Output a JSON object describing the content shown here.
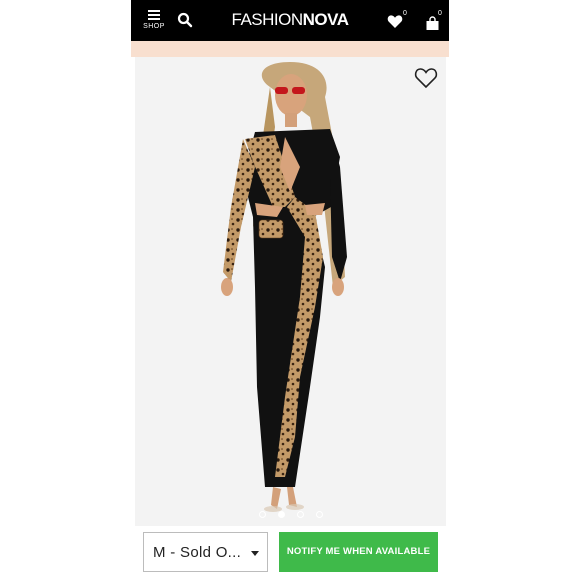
{
  "header": {
    "menu_label": "SHOP",
    "menu_icon": "hamburger-icon",
    "search_icon": "search-icon",
    "logo_part1": "FASHION",
    "logo_part2": "NOVA",
    "wishlist_count": "0",
    "cart_count": "0"
  },
  "product": {
    "image_description_icon": "product-photo",
    "wishlist_icon": "heart-outline-icon",
    "gallery_pages": 4,
    "active_page": 2
  },
  "actions": {
    "size_value": "M - Sold O...",
    "notify_label": "NOTIFY ME WHEN AVAILABLE"
  },
  "colors": {
    "topbar": "#000000",
    "promo_strip": "#f8dfcf",
    "notify_button": "#3fba4a"
  }
}
